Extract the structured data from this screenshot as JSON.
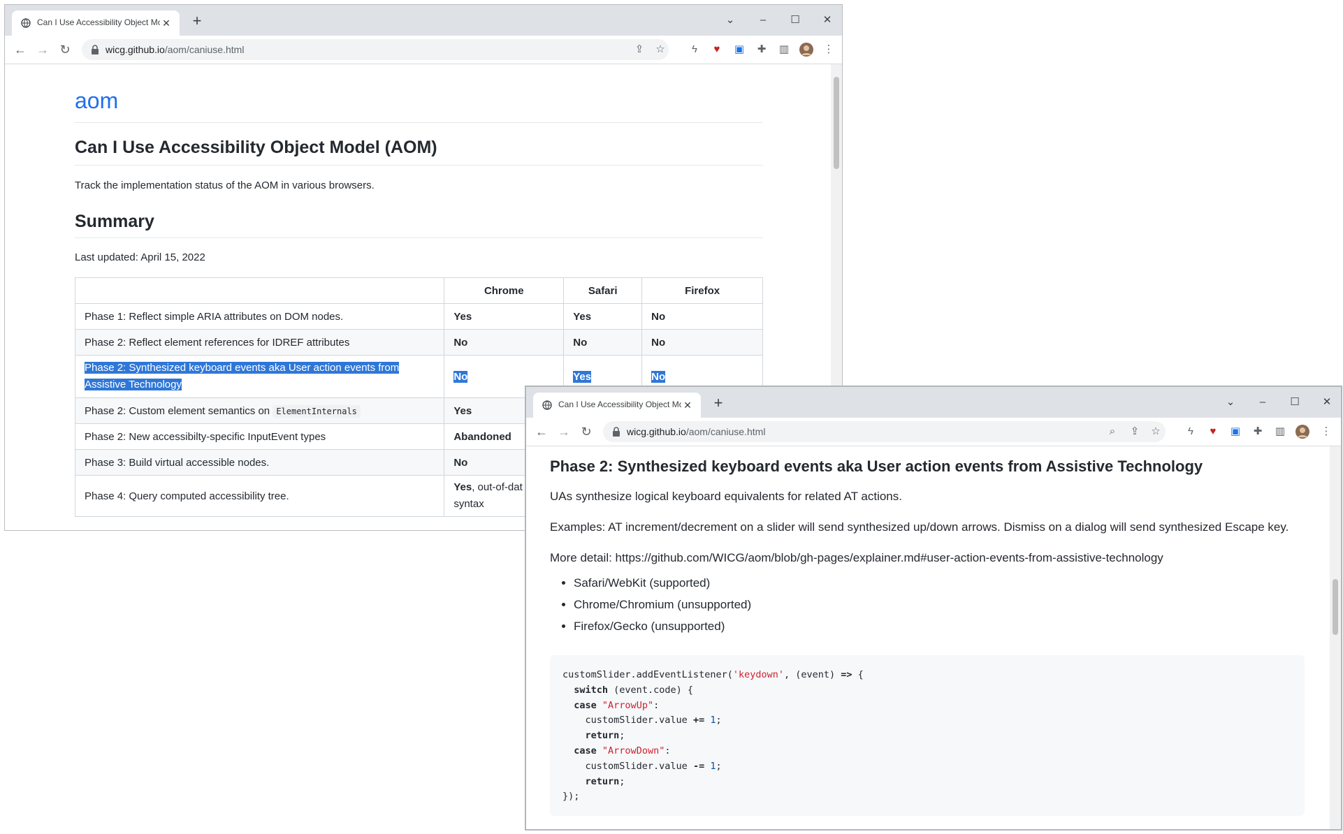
{
  "window1": {
    "tab_title": "Can I Use Accessibility Object Mo",
    "url_host": "wicg.github.io",
    "url_path": "/aom/caniuse.html",
    "site_title": "aom",
    "page_heading": "Can I Use Accessibility Object Model (AOM)",
    "intro": "Track the implementation status of the AOM in various browsers.",
    "summary_heading": "Summary",
    "last_updated": "Last updated: April 15, 2022",
    "table": {
      "headers": [
        "",
        "Chrome",
        "Safari",
        "Firefox"
      ],
      "rows": [
        {
          "feature": "Phase 1: Reflect simple ARIA attributes on DOM nodes.",
          "chrome": "Yes",
          "safari": "Yes",
          "firefox": "No"
        },
        {
          "feature": "Phase 2: Reflect element references for IDREF attributes",
          "chrome": "No",
          "safari": "No",
          "firefox": "No"
        },
        {
          "feature_line1": "Phase 2: Synthesized keyboard events aka User action events from",
          "feature_line2": "Assistive Technology",
          "chrome": "No",
          "safari": "Yes",
          "firefox": "No"
        },
        {
          "feature": "Phase 2: Custom element semantics on",
          "feature_code": "ElementInternals",
          "chrome": "Yes"
        },
        {
          "feature": "Phase 2: New accessibilty-specific InputEvent types",
          "chrome": "Abandoned"
        },
        {
          "feature": "Phase 3: Build virtual accessible nodes.",
          "chrome": "No"
        },
        {
          "feature": "Phase 4: Query computed accessibility tree.",
          "chrome_bold": "Yes",
          "chrome_rest": ", out-of-dat",
          "chrome_line2": "syntax"
        }
      ]
    }
  },
  "window2": {
    "tab_title": "Can I Use Accessibility Object Mo",
    "url_host": "wicg.github.io",
    "url_path": "/aom/caniuse.html",
    "heading": "Phase 2: Synthesized keyboard events aka User action events from Assistive Technology",
    "para1": "UAs synthesize logical keyboard equivalents for related AT actions.",
    "para2": "Examples: AT increment/decrement on a slider will send synthesized up/down arrows. Dismiss on a dialog will send synthesized Escape key.",
    "para3": "More detail: https://github.com/WICG/aom/blob/gh-pages/explainer.md#user-action-events-from-assistive-technology",
    "bullets": [
      "Safari/WebKit (supported)",
      "Chrome/Chromium (unsupported)",
      "Firefox/Gecko (unsupported)"
    ],
    "code": {
      "l1a": "customSlider.addEventListener(",
      "l1str": "'keydown'",
      "l1b": ", (event) ",
      "l1op": "=>",
      "l1c": " {",
      "l2kw": "switch",
      "l2b": " (event.code) {",
      "l3kw": "case",
      "l3str": "\"ArrowUp\"",
      "l3b": ":",
      "l4a": "customSlider.value ",
      "l4op": "+=",
      "l4num": "1",
      "l4b": ";",
      "l5kw": "return",
      "l5b": ";",
      "l6kw": "case",
      "l6str": "\"ArrowDown\"",
      "l6b": ":",
      "l7a": "customSlider.value ",
      "l7op": "-=",
      "l7num": "1",
      "l7b": ";",
      "l8kw": "return",
      "l8b": ";",
      "l9": "});"
    }
  },
  "icons": [
    "globe-icon",
    "close-icon",
    "new-tab-icon",
    "chevron-down-icon",
    "minimize-icon",
    "maximize-icon",
    "back-icon",
    "forward-icon",
    "reload-icon",
    "lock-icon",
    "zoom-icon",
    "share-icon",
    "star-icon",
    "bolt-icon",
    "heart-icon",
    "extension-icon",
    "puzzle-icon",
    "side-panel-icon",
    "avatar",
    "menu-icon"
  ],
  "colors": {
    "link": "#1f6feb",
    "selection": "#2f77d7",
    "tabstrip": "#dee1e6",
    "code_string": "#cf222e",
    "code_number": "#0550ae"
  }
}
